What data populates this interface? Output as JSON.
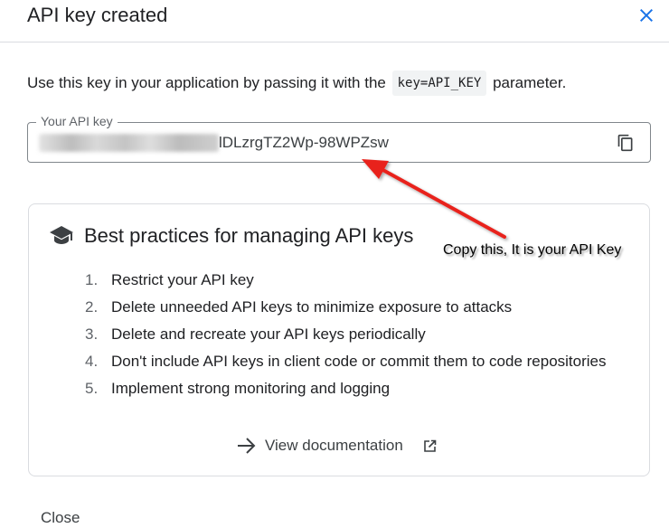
{
  "dialog": {
    "title": "API key created",
    "intro_before": "Use this key in your application by passing it with the",
    "intro_code": "key=API_KEY",
    "intro_after": "parameter.",
    "close_label": "Close"
  },
  "api_key": {
    "label": "Your API key",
    "visible_suffix": "lDLzrgTZ2Wp-98WPZsw"
  },
  "best_practices": {
    "title": "Best practices for managing API keys",
    "items": [
      {
        "num": "1.",
        "text": "Restrict your API key"
      },
      {
        "num": "2.",
        "text": "Delete unneeded API keys to minimize exposure to attacks"
      },
      {
        "num": "3.",
        "text": "Delete and recreate your API keys periodically"
      },
      {
        "num": "4.",
        "text": "Don't include API keys in client code or commit them to code repositories"
      },
      {
        "num": "5.",
        "text": "Implement strong monitoring and logging"
      }
    ],
    "doc_link": "View documentation"
  },
  "annotation": {
    "text": "Copy this, It is your API Key",
    "color": "#e8231d"
  },
  "icons": {
    "close": "close-icon",
    "copy": "copy-icon",
    "hat": "graduation-cap-icon",
    "arrow": "arrow-right-icon",
    "external": "external-link-icon"
  },
  "colors": {
    "accent": "#1a73e8",
    "border": "#dadce0",
    "text": "#202124"
  }
}
